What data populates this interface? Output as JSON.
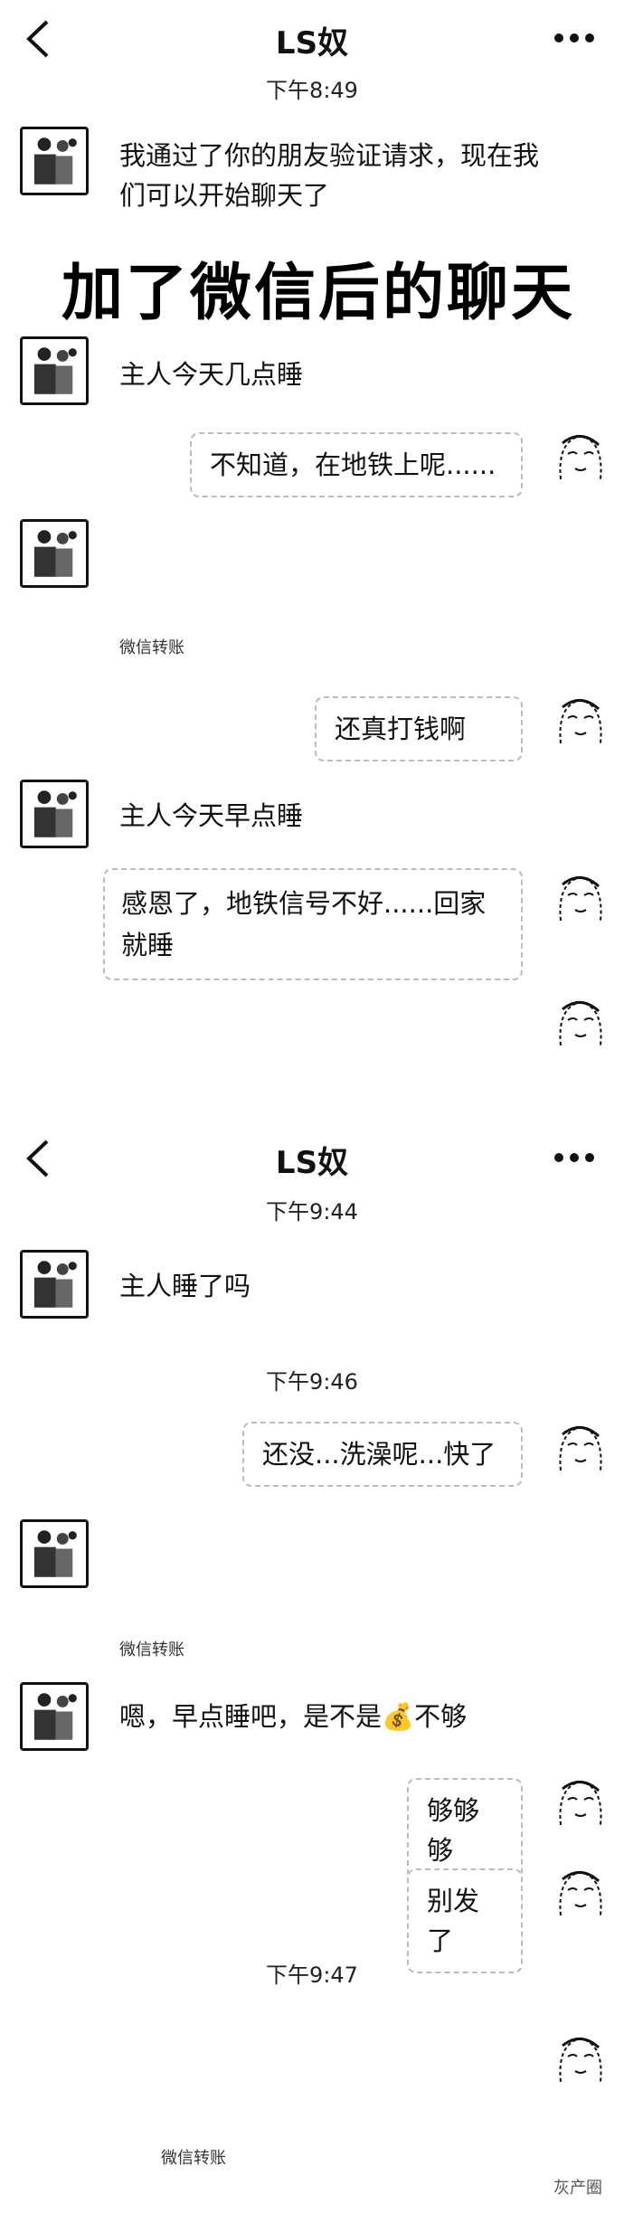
{
  "screen1": {
    "header": {
      "title": "LS奴"
    },
    "time1": "下午8:49",
    "messages": {
      "system_msg": "我通过了你的朋友验证请求，现在我们可以开始聊天了",
      "m1": "主人今天几点睡",
      "m2": "不知道，在地铁上呢......",
      "transfer1": "微信转账",
      "m3": "还真打钱啊",
      "m4": "主人今天早点睡",
      "m5": "感恩了，地铁信号不好......回家就睡"
    }
  },
  "overlay_caption": "加了微信后的聊天",
  "screen2": {
    "header": {
      "title": "LS奴"
    },
    "time1": "下午9:44",
    "m1": "主人睡了吗",
    "time2": "下午9:46",
    "m2": "还没...洗澡呢...快了",
    "transfer1": "微信转账",
    "m3_pre": "嗯，早点睡吧，是不是",
    "m3_emoji": "💰",
    "m3_post": "不够",
    "m4": "够够够",
    "m5": "别发了",
    "time3": "下午9:47",
    "transfer2": "微信转账"
  },
  "watermark": "灰产圈"
}
